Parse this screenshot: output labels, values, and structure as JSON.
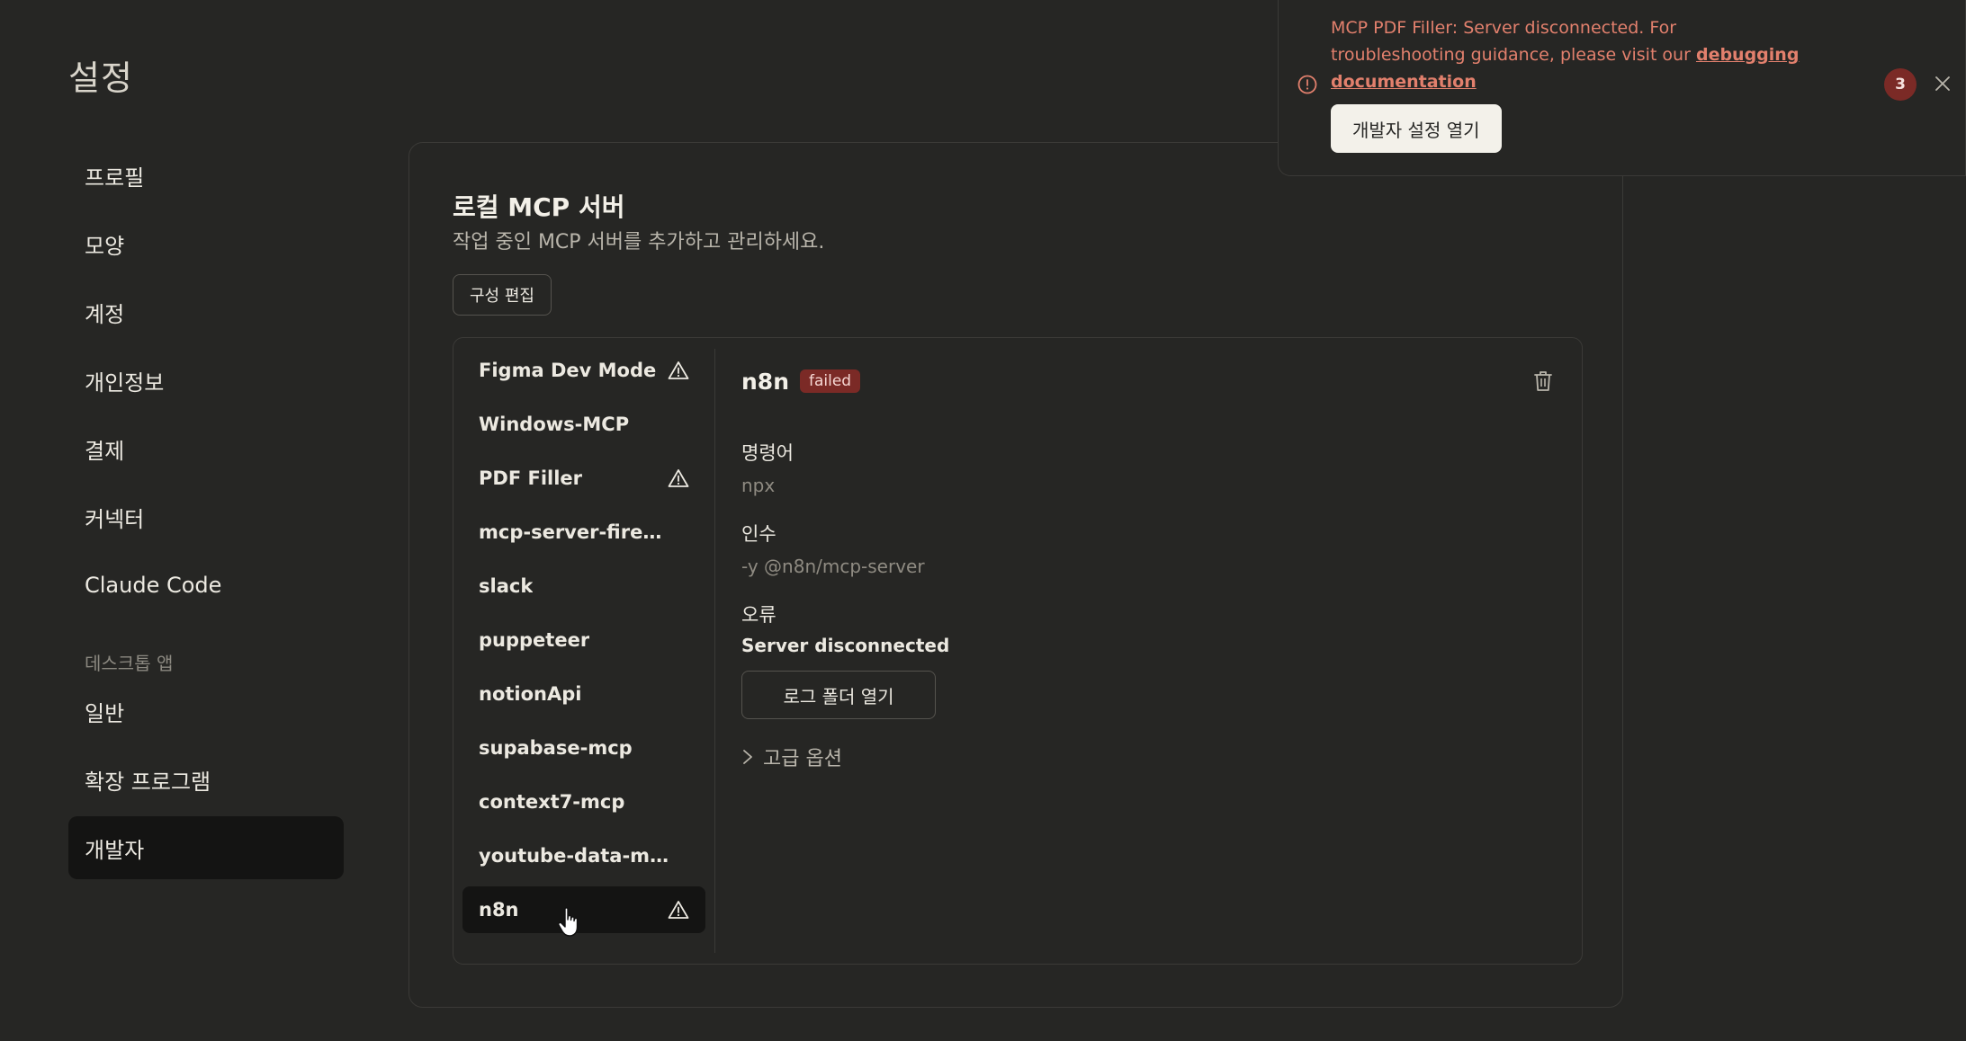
{
  "page": {
    "title": "설정"
  },
  "sidebar": {
    "items": [
      {
        "label": "프로필"
      },
      {
        "label": "모양"
      },
      {
        "label": "계정"
      },
      {
        "label": "개인정보"
      },
      {
        "label": "결제"
      },
      {
        "label": "커넥터"
      },
      {
        "label": "Claude Code"
      }
    ],
    "group_label": "데스크톱 앱",
    "group_items": [
      {
        "label": "일반"
      },
      {
        "label": "확장 프로그램"
      },
      {
        "label": "개발자",
        "active": true
      }
    ]
  },
  "panel": {
    "heading": "로컬 MCP 서버",
    "subtitle": "작업 중인 MCP 서버를 추가하고 관리하세요.",
    "edit_button": "구성 편집"
  },
  "servers": [
    {
      "name": "Figma Dev Mode",
      "warning": true
    },
    {
      "name": "Windows-MCP",
      "warning": false
    },
    {
      "name": "PDF Filler",
      "warning": true
    },
    {
      "name": "mcp-server-firecr...",
      "warning": false
    },
    {
      "name": "slack",
      "warning": false
    },
    {
      "name": "puppeteer",
      "warning": false
    },
    {
      "name": "notionApi",
      "warning": false
    },
    {
      "name": "supabase-mcp",
      "warning": false
    },
    {
      "name": "context7-mcp",
      "warning": false
    },
    {
      "name": "youtube-data-mcp...",
      "warning": false
    },
    {
      "name": "n8n",
      "warning": true,
      "selected": true
    }
  ],
  "detail": {
    "name": "n8n",
    "status": "failed",
    "command_label": "명령어",
    "command_value": "npx",
    "args_label": "인수",
    "args_value": "-y @n8n/mcp-server",
    "error_label": "오류",
    "error_value": "Server disconnected",
    "log_button": "로그 폴더 열기",
    "advanced_label": "고급 옵션"
  },
  "toast": {
    "message_line1": "MCP PDF Filler: Server disconnected. For",
    "message_line2": "troubleshooting guidance, please visit our",
    "link_part1": "debugging",
    "link_part2": "documentation",
    "button": "개발자 설정 열기",
    "count": "3"
  },
  "colors": {
    "background": "#262624",
    "active_item": "#141413",
    "badge": "#7b2a26",
    "error_text": "#e2806d"
  },
  "icons": [
    "warning-icon",
    "trash-icon",
    "chevron-right-icon",
    "info-circle-icon",
    "close-icon",
    "hand-cursor-icon"
  ]
}
